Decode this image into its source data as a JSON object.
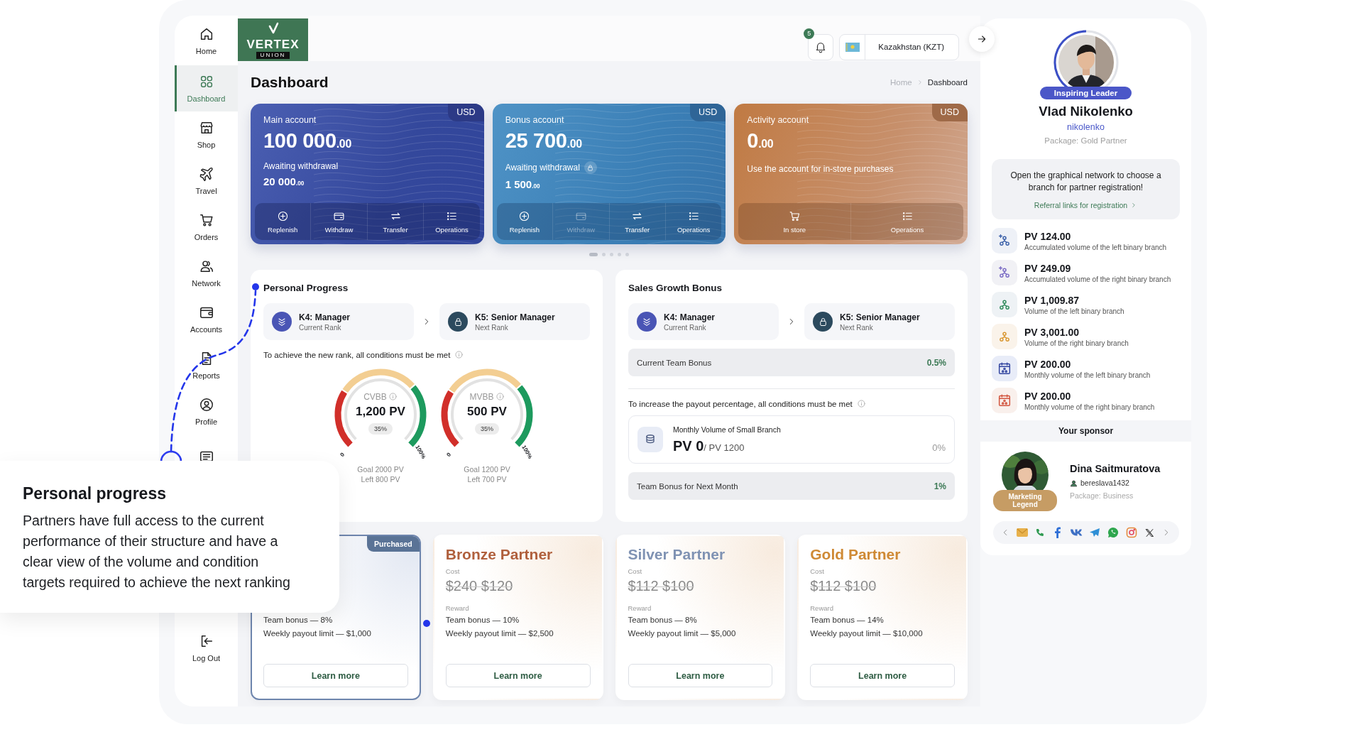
{
  "sidebar": {
    "items": [
      {
        "label": "Home",
        "selected": false
      },
      {
        "label": "Dashboard",
        "selected": true
      },
      {
        "label": "Shop",
        "selected": false
      },
      {
        "label": "Travel",
        "selected": false
      },
      {
        "label": "Orders",
        "selected": false
      },
      {
        "label": "Network",
        "selected": false
      },
      {
        "label": "Accounts",
        "selected": false
      },
      {
        "label": "Reports",
        "selected": false
      },
      {
        "label": "Profile",
        "selected": false
      },
      {
        "selected": false
      }
    ],
    "logout": {
      "label": "Log Out"
    }
  },
  "header": {
    "logo": {
      "name": "VERTEX",
      "tagline": "UNION"
    },
    "notifications": {
      "count": "5"
    },
    "region": {
      "label": "Kazakhstan (KZT)"
    }
  },
  "page": {
    "title": "Dashboard",
    "breadcrumbs": [
      {
        "label": "Home",
        "selected": false
      },
      {
        "label": "Dashboard",
        "selected": true
      }
    ]
  },
  "accounts": [
    {
      "kind": "main",
      "title": "Main account",
      "currency": "USD",
      "amount": "100 000",
      "cents": ".00",
      "pending_label": "Awaiting withdrawal",
      "pending_amount": "20 000",
      "pending_cents": ".00",
      "locked": false,
      "actions": [
        {
          "kind": "replenish",
          "label": "Replenish",
          "disabled": false
        },
        {
          "kind": "withdraw",
          "label": "Withdraw",
          "disabled": false
        },
        {
          "kind": "transfer",
          "label": "Transfer",
          "disabled": false
        },
        {
          "kind": "operations",
          "label": "Operations",
          "disabled": false
        }
      ]
    },
    {
      "kind": "bonus",
      "title": "Bonus account",
      "currency": "USD",
      "amount": "25 700",
      "cents": ".00",
      "pending_label": "Awaiting withdrawal",
      "pending_amount": "1 500",
      "pending_cents": ".00",
      "locked": true,
      "actions": [
        {
          "kind": "replenish",
          "label": "Replenish",
          "disabled": false
        },
        {
          "kind": "withdraw",
          "label": "Withdraw",
          "disabled": true
        },
        {
          "kind": "transfer",
          "label": "Transfer",
          "disabled": false
        },
        {
          "kind": "operations",
          "label": "Operations",
          "disabled": false
        }
      ]
    },
    {
      "kind": "activity",
      "title": "Activity account",
      "currency": "USD",
      "amount": "0",
      "cents": ".00",
      "note": "Use the account for in-store purchases",
      "actions": [
        {
          "kind": "store",
          "label": "In store",
          "disabled": false
        },
        {
          "kind": "operations",
          "label": "Operations",
          "disabled": false
        }
      ]
    }
  ],
  "carousel": {
    "dots": [
      {
        "selected": true
      },
      {
        "selected": false
      },
      {
        "selected": false
      },
      {
        "selected": false
      },
      {
        "selected": false
      }
    ]
  },
  "progress": {
    "title": "Personal Progress",
    "current_rank": {
      "name": "K4: Manager",
      "caption": "Current Rank"
    },
    "next_rank": {
      "name": "K5: Senior Manager",
      "caption": "Next Rank"
    },
    "condition_note": "To achieve the new rank, all conditions must be met",
    "gauges": [
      {
        "label": "CVBB",
        "value": "1,200 PV",
        "percent": "35%",
        "min": "0",
        "max": "100%",
        "goal": "Goal 2000 PV",
        "left": "Left 800 PV"
      },
      {
        "label": "MVBB",
        "value": "500 PV",
        "percent": "35%",
        "min": "0",
        "max": "100%",
        "goal": "Goal 1200 PV",
        "left": "Left 700 PV"
      }
    ]
  },
  "sales": {
    "title": "Sales Growth Bonus",
    "current_rank": {
      "name": "K4: Manager",
      "caption": "Current Rank"
    },
    "next_rank": {
      "name": "K5: Senior Manager",
      "caption": "Next Rank"
    },
    "current_bonus": {
      "label": "Current Team Bonus",
      "value": "0.5%"
    },
    "condition_note": "To increase the payout percentage, all conditions must be met",
    "volume": {
      "label": "Monthly Volume of Small Branch",
      "value": "PV 0",
      "target": "/ PV 1200",
      "percent": "0%"
    },
    "next_bonus": {
      "label": "Team Bonus for Next Month",
      "value": "1%"
    }
  },
  "plans": [
    {
      "badge": "Purchased",
      "rewards": [
        "Team bonus — 8%",
        "Weekly payout limit — $1,000"
      ],
      "button": "Learn more",
      "selected": true
    },
    {
      "name": "Bronze Partner",
      "color": "#b0603d",
      "cost_label": "Cost",
      "price": "$240 $120",
      "reward_label": "Reward",
      "rewards": [
        "Team bonus — 10%",
        "Weekly payout limit — $2,500"
      ],
      "button": "Learn more",
      "selected": false
    },
    {
      "name": "Silver Partner",
      "color": "#7f92b3",
      "cost_label": "Cost",
      "price": "$112 $100",
      "reward_label": "Reward",
      "rewards": [
        "Team bonus — 8%",
        "Weekly payout limit — $5,000"
      ],
      "button": "Learn more",
      "selected": false
    },
    {
      "name": "Gold Partner",
      "color": "#cf8a35",
      "cost_label": "Cost",
      "price": "$112 $100",
      "reward_label": "Reward",
      "rewards": [
        "Team bonus — 14%",
        "Weekly payout limit — $10,000"
      ],
      "button": "Learn more",
      "selected": false
    }
  ],
  "profile": {
    "rank_badge": "Inspiring Leader",
    "name": "Vlad Nikolenko",
    "username": "nikolenko",
    "package": "Package: Gold Partner",
    "referral": {
      "text": "Open the graphical network to choose a branch for partner registration!",
      "link": "Referral links for registration"
    },
    "stats": [
      {
        "value": "PV 124.00",
        "caption": "Accumulated volume of the left binary branch"
      },
      {
        "value": "PV 249.09",
        "caption": "Accumulated volume of the right binary branch"
      },
      {
        "value": "PV 1,009.87",
        "caption": "Volume of the left binary branch"
      },
      {
        "value": "PV 3,001.00",
        "caption": "Volume of the right binary branch"
      },
      {
        "value": "PV 200.00",
        "caption": "Monthly volume of the left binary branch"
      },
      {
        "value": "PV 200.00",
        "caption": "Monthly volume of the right binary branch"
      }
    ],
    "sponsor": {
      "heading": "Your sponsor",
      "badge": "Marketing Legend",
      "name": "Dina Saitmuratova",
      "username": "bereslava1432",
      "package": "Package: Business"
    }
  },
  "tooltip": {
    "title": "Personal progress",
    "text": "Partners have full access to the current performance of their structure and have a clear view of the volume and condition targets required to achieve the next ranking"
  }
}
